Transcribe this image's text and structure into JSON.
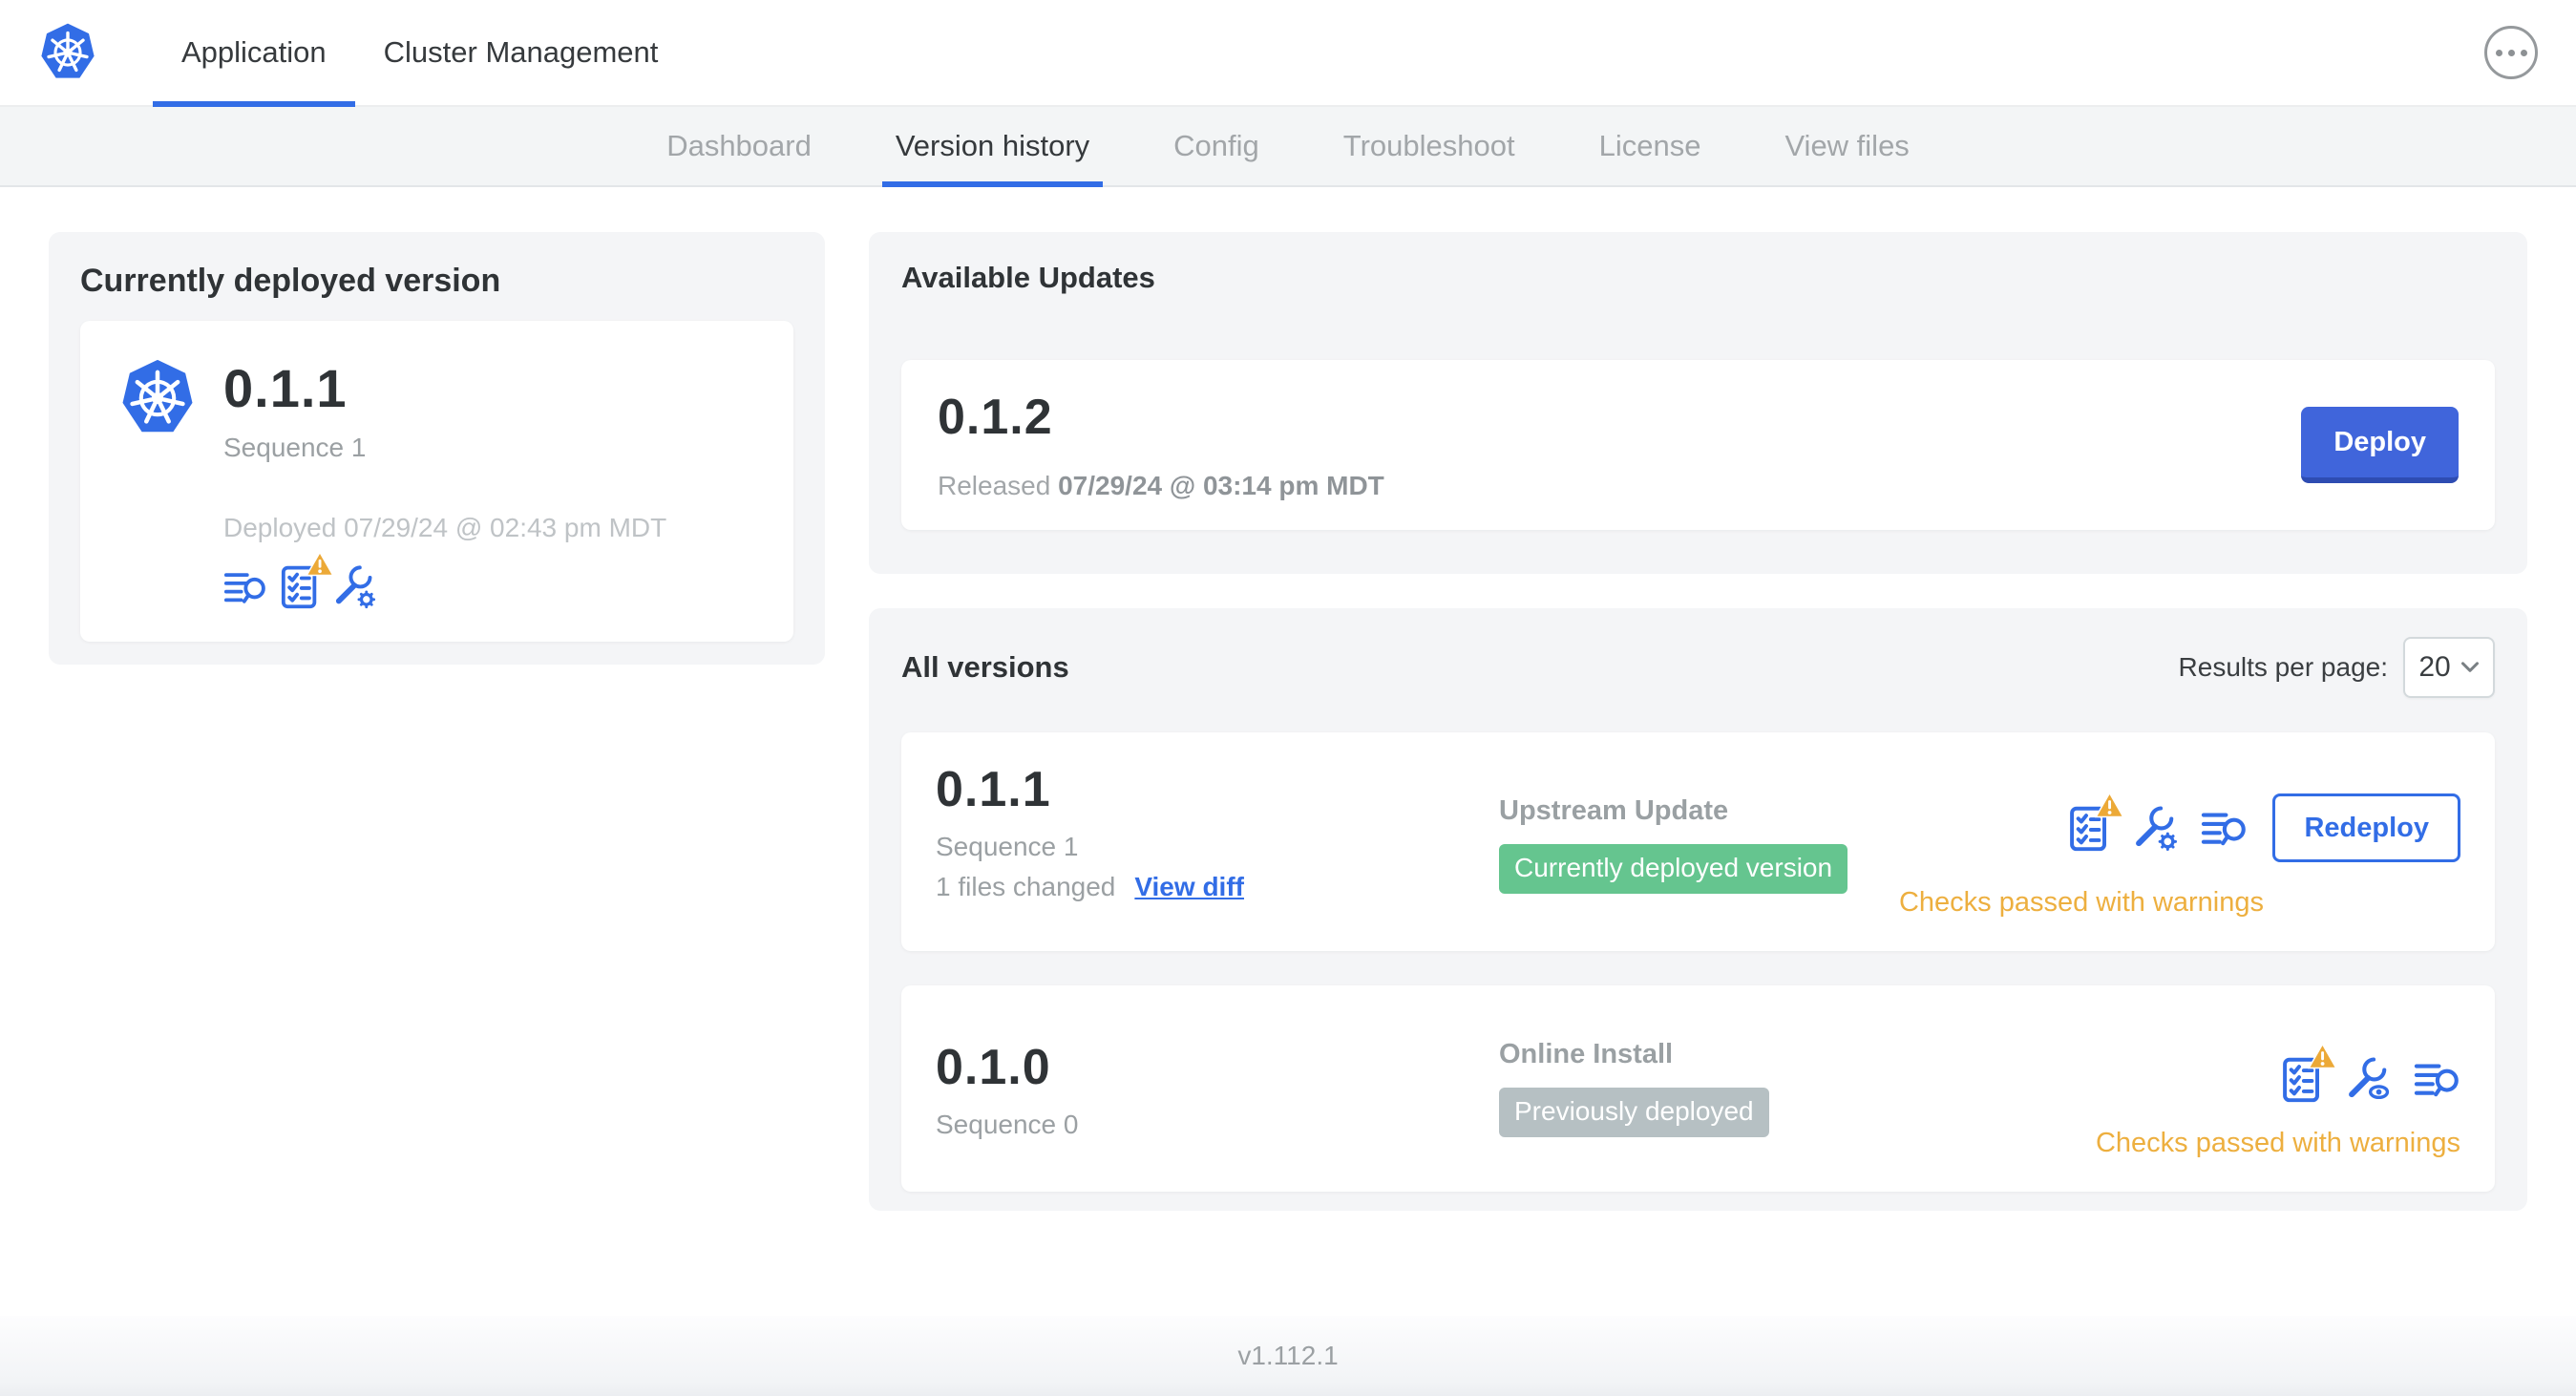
{
  "topbar": {
    "tabs": [
      {
        "label": "Application",
        "active": true
      },
      {
        "label": "Cluster Management",
        "active": false
      }
    ],
    "more_menu_icon": "ellipsis-icon"
  },
  "subnav": {
    "tabs": [
      "Dashboard",
      "Version history",
      "Config",
      "Troubleshoot",
      "License",
      "View files"
    ],
    "active": "Version history"
  },
  "current_version_card": {
    "title": "Currently deployed version",
    "version": "0.1.1",
    "sequence": "Sequence 1",
    "deployed": "Deployed 07/29/24 @ 02:43 pm MDT",
    "icons": [
      "version-diff-icon",
      "preflight-checks-warning-icon",
      "edit-config-icon"
    ]
  },
  "available_updates": {
    "title": "Available Updates",
    "version": "0.1.2",
    "released_label": "Released",
    "released_date": "07/29/24 @ 03:14 pm MDT",
    "deploy_label": "Deploy"
  },
  "all_versions": {
    "title": "All versions",
    "results_per_page_label": "Results per page:",
    "results_per_page_value": "20",
    "rows": [
      {
        "version": "0.1.1",
        "sequence": "Sequence 1",
        "files_changed": "1 files changed",
        "view_diff_label": "View diff",
        "source": "Upstream Update",
        "badge": "Currently deployed version",
        "badge_color": "green",
        "status": "Checks passed with warnings",
        "action_label": "Redeploy",
        "icons": [
          "preflight-checks-warning-icon",
          "edit-config-icon",
          "version-diff-icon"
        ]
      },
      {
        "version": "0.1.0",
        "sequence": "Sequence 0",
        "source": "Online Install",
        "badge": "Previously deployed",
        "badge_color": "gray",
        "status": "Checks passed with warnings",
        "icons": [
          "preflight-checks-warning-icon",
          "view-config-icon",
          "version-diff-icon"
        ]
      }
    ]
  },
  "footer": {
    "version": "v1.112.1"
  },
  "colors": {
    "accent_blue": "#326DE6",
    "deploy_button": "#4065DB",
    "warning_amber": "#EDAF3F",
    "badge_green": "#65C58F",
    "badge_gray": "#B6C0C3"
  }
}
